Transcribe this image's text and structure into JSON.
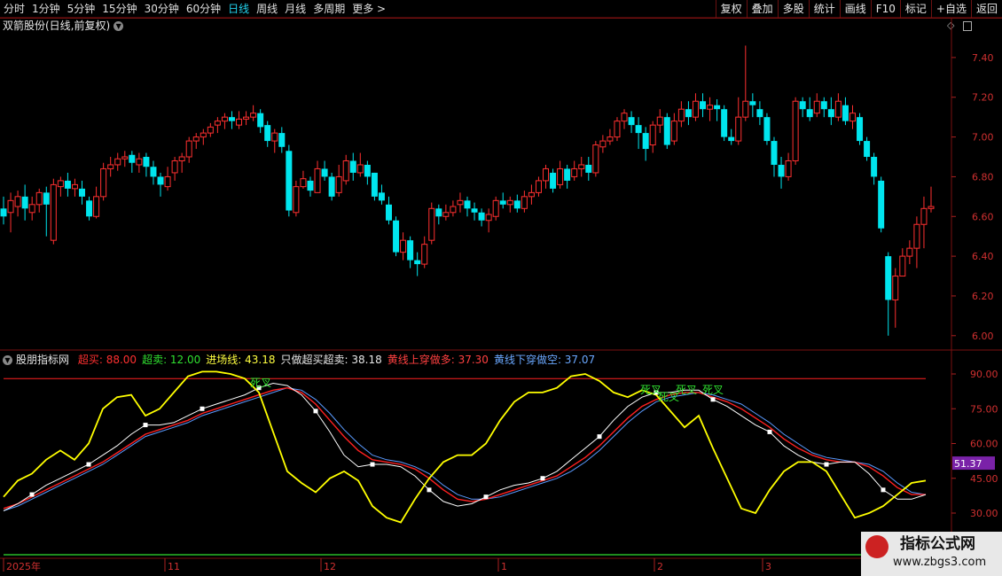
{
  "toolbar": {
    "periods": [
      "分时",
      "1分钟",
      "5分钟",
      "15分钟",
      "30分钟",
      "60分钟",
      "日线",
      "周线",
      "月线",
      "多周期",
      "更多 >"
    ],
    "active_period": "日线",
    "right_buttons": [
      "复权",
      "叠加",
      "多股",
      "统计",
      "画线",
      "F10",
      "标记",
      "+自选",
      "返回"
    ]
  },
  "stock": {
    "title": "双箭股份(日线,前复权)"
  },
  "price_axis": {
    "labels": [
      "7.40",
      "7.20",
      "7.00",
      "6.80",
      "6.60",
      "6.40",
      "6.20",
      "6.00"
    ]
  },
  "indicator": {
    "name": "股朋指标网",
    "params": [
      {
        "label": "超买: 88.00",
        "color": "#ff3030"
      },
      {
        "label": "超卖: 12.00",
        "color": "#30e030"
      },
      {
        "label": "进场线: 43.18",
        "color": "#ffff40"
      },
      {
        "label": "只做超买超卖: 38.18",
        "color": "#e8e8e8"
      },
      {
        "label": "黄线上穿做多: 37.30",
        "color": "#ff4040"
      },
      {
        "label": "黄线下穿做空: 37.07",
        "color": "#6aa8ff"
      }
    ],
    "axis_labels": [
      "90.00",
      "75.00",
      "60.00",
      "45.00",
      "30.00"
    ],
    "current_value": "51.37",
    "signals": [
      "死叉",
      "死叉",
      "死叉",
      "死叉"
    ]
  },
  "date_axis": {
    "labels": [
      "2025年",
      "11",
      "12",
      "1",
      "2",
      "3"
    ]
  },
  "watermark": {
    "text": "指标公式网",
    "url": "www.zbgs3.com"
  },
  "colors": {
    "up": "#ff3030",
    "down": "#00e5ee",
    "yellow": "#ffff00",
    "white": "#ffffff",
    "red_line": "#ff2020",
    "blue_line": "#5a9bff"
  },
  "chart_data": {
    "type": "candlestick",
    "candles": [
      [
        6.64,
        6.6,
        6.7,
        6.56
      ],
      [
        6.62,
        6.68,
        6.72,
        6.52
      ],
      [
        6.65,
        6.7,
        6.73,
        6.6
      ],
      [
        6.7,
        6.64,
        6.76,
        6.58
      ],
      [
        6.62,
        6.66,
        6.7,
        6.58
      ],
      [
        6.66,
        6.72,
        6.74,
        6.62
      ],
      [
        6.72,
        6.66,
        6.75,
        6.5
      ],
      [
        6.48,
        6.76,
        6.79,
        6.46
      ],
      [
        6.75,
        6.78,
        6.8,
        6.7
      ],
      [
        6.78,
        6.74,
        6.82,
        6.7
      ],
      [
        6.74,
        6.76,
        6.79,
        6.7
      ],
      [
        6.74,
        6.7,
        6.78,
        6.66
      ],
      [
        6.68,
        6.6,
        6.7,
        6.58
      ],
      [
        6.6,
        6.7,
        6.75,
        6.59
      ],
      [
        6.7,
        6.84,
        6.87,
        6.68
      ],
      [
        6.84,
        6.86,
        6.9,
        6.8
      ],
      [
        6.86,
        6.89,
        6.92,
        6.83
      ],
      [
        6.89,
        6.9,
        6.93,
        6.85
      ],
      [
        6.91,
        6.87,
        6.93,
        6.82
      ],
      [
        6.86,
        6.89,
        6.92,
        6.82
      ],
      [
        6.9,
        6.85,
        6.92,
        6.8
      ],
      [
        6.85,
        6.8,
        6.88,
        6.76
      ],
      [
        6.8,
        6.76,
        6.82,
        6.7
      ],
      [
        6.75,
        6.8,
        6.85,
        6.73
      ],
      [
        6.82,
        6.88,
        6.9,
        6.78
      ],
      [
        6.88,
        6.9,
        6.92,
        6.82
      ],
      [
        6.9,
        6.98,
        7.0,
        6.87
      ],
      [
        6.98,
        7.0,
        7.02,
        6.94
      ],
      [
        7.0,
        7.02,
        7.04,
        6.96
      ],
      [
        7.02,
        7.05,
        7.07,
        7.0
      ],
      [
        7.06,
        7.08,
        7.1,
        7.02
      ],
      [
        7.08,
        7.1,
        7.12,
        7.04
      ],
      [
        7.1,
        7.08,
        7.13,
        7.04
      ],
      [
        7.06,
        7.09,
        7.13,
        7.04
      ],
      [
        7.09,
        7.1,
        7.13,
        7.06
      ],
      [
        7.1,
        7.12,
        7.16,
        7.08
      ],
      [
        7.12,
        7.05,
        7.14,
        7.02
      ],
      [
        7.06,
        6.98,
        7.08,
        6.95
      ],
      [
        6.98,
        7.02,
        7.04,
        6.92
      ],
      [
        7.02,
        6.95,
        7.05,
        6.92
      ],
      [
        6.93,
        6.63,
        6.96,
        6.6
      ],
      [
        6.62,
        6.75,
        6.78,
        6.6
      ],
      [
        6.75,
        6.79,
        6.83,
        6.74
      ],
      [
        6.78,
        6.73,
        6.8,
        6.7
      ],
      [
        6.72,
        6.84,
        6.88,
        6.72
      ],
      [
        6.84,
        6.8,
        6.88,
        6.78
      ],
      [
        6.8,
        6.7,
        6.82,
        6.68
      ],
      [
        6.72,
        6.8,
        6.86,
        6.7
      ],
      [
        6.78,
        6.88,
        6.91,
        6.76
      ],
      [
        6.88,
        6.82,
        6.92,
        6.78
      ],
      [
        6.82,
        6.86,
        6.92,
        6.8
      ],
      [
        6.86,
        6.8,
        6.88,
        6.76
      ],
      [
        6.82,
        6.7,
        6.82,
        6.68
      ],
      [
        6.72,
        6.68,
        6.76,
        6.66
      ],
      [
        6.66,
        6.58,
        6.7,
        6.56
      ],
      [
        6.58,
        6.42,
        6.6,
        6.4
      ],
      [
        6.42,
        6.48,
        6.52,
        6.38
      ],
      [
        6.48,
        6.38,
        6.5,
        6.34
      ],
      [
        6.38,
        6.36,
        6.42,
        6.3
      ],
      [
        6.36,
        6.46,
        6.5,
        6.34
      ],
      [
        6.48,
        6.64,
        6.67,
        6.46
      ],
      [
        6.64,
        6.6,
        6.66,
        6.56
      ],
      [
        6.6,
        6.62,
        6.66,
        6.58
      ],
      [
        6.62,
        6.65,
        6.68,
        6.6
      ],
      [
        6.66,
        6.68,
        6.72,
        6.62
      ],
      [
        6.68,
        6.64,
        6.7,
        6.6
      ],
      [
        6.64,
        6.62,
        6.67,
        6.58
      ],
      [
        6.62,
        6.58,
        6.64,
        6.55
      ],
      [
        6.58,
        6.61,
        6.64,
        6.52
      ],
      [
        6.6,
        6.68,
        6.7,
        6.58
      ],
      [
        6.68,
        6.66,
        6.72,
        6.64
      ],
      [
        6.66,
        6.68,
        6.7,
        6.62
      ],
      [
        6.68,
        6.64,
        6.71,
        6.62
      ],
      [
        6.64,
        6.7,
        6.73,
        6.62
      ],
      [
        6.7,
        6.72,
        6.76,
        6.66
      ],
      [
        6.72,
        6.78,
        6.8,
        6.7
      ],
      [
        6.78,
        6.84,
        6.86,
        6.74
      ],
      [
        6.82,
        6.74,
        6.84,
        6.72
      ],
      [
        6.76,
        6.84,
        6.88,
        6.74
      ],
      [
        6.84,
        6.78,
        6.86,
        6.74
      ],
      [
        6.8,
        6.84,
        6.88,
        6.78
      ],
      [
        6.84,
        6.86,
        6.9,
        6.8
      ],
      [
        6.86,
        6.82,
        6.9,
        6.78
      ],
      [
        6.82,
        6.96,
        6.98,
        6.8
      ],
      [
        6.95,
        6.98,
        7.01,
        6.92
      ],
      [
        6.98,
        7.0,
        7.04,
        6.96
      ],
      [
        7.0,
        7.08,
        7.1,
        6.98
      ],
      [
        7.08,
        7.12,
        7.14,
        7.04
      ],
      [
        7.1,
        7.06,
        7.13,
        7.02
      ],
      [
        7.06,
        7.02,
        7.1,
        6.94
      ],
      [
        7.02,
        6.94,
        7.05,
        6.88
      ],
      [
        6.96,
        7.06,
        7.08,
        6.92
      ],
      [
        7.06,
        7.1,
        7.14,
        7.02
      ],
      [
        7.1,
        6.96,
        7.12,
        6.94
      ],
      [
        6.98,
        7.08,
        7.12,
        6.96
      ],
      [
        7.08,
        7.14,
        7.18,
        7.05
      ],
      [
        7.14,
        7.1,
        7.18,
        7.06
      ],
      [
        7.1,
        7.18,
        7.22,
        7.08
      ],
      [
        7.18,
        7.14,
        7.22,
        7.1
      ],
      [
        7.14,
        7.16,
        7.2,
        7.08
      ],
      [
        7.16,
        7.14,
        7.19,
        7.08
      ],
      [
        7.14,
        7.0,
        7.16,
        6.98
      ],
      [
        7.0,
        6.98,
        7.04,
        6.96
      ],
      [
        6.98,
        7.1,
        7.2,
        6.96
      ],
      [
        7.1,
        7.18,
        7.46,
        7.08
      ],
      [
        7.18,
        7.16,
        7.22,
        7.1
      ],
      [
        7.14,
        7.1,
        7.18,
        7.06
      ],
      [
        7.1,
        6.98,
        7.12,
        6.96
      ],
      [
        6.98,
        6.86,
        7.0,
        6.8
      ],
      [
        6.86,
        6.8,
        6.9,
        6.74
      ],
      [
        6.8,
        6.88,
        6.92,
        6.78
      ],
      [
        6.88,
        7.18,
        7.2,
        6.86
      ],
      [
        7.18,
        7.14,
        7.2,
        7.1
      ],
      [
        7.14,
        7.1,
        7.2,
        7.08
      ],
      [
        7.12,
        7.18,
        7.22,
        7.1
      ],
      [
        7.18,
        7.14,
        7.2,
        7.1
      ],
      [
        7.14,
        7.1,
        7.2,
        7.06
      ],
      [
        7.1,
        7.18,
        7.22,
        7.08
      ],
      [
        7.16,
        7.08,
        7.2,
        7.06
      ],
      [
        7.08,
        7.12,
        7.16,
        7.04
      ],
      [
        7.1,
        6.98,
        7.12,
        6.96
      ],
      [
        6.98,
        6.9,
        7.0,
        6.88
      ],
      [
        6.9,
        6.8,
        6.92,
        6.76
      ],
      [
        6.78,
        6.54,
        6.8,
        6.52
      ],
      [
        6.4,
        6.18,
        6.42,
        6.0
      ],
      [
        6.18,
        6.3,
        6.34,
        6.04
      ],
      [
        6.3,
        6.4,
        6.44,
        6.3
      ],
      [
        6.4,
        6.44,
        6.48,
        6.36
      ],
      [
        6.44,
        6.56,
        6.6,
        6.34
      ],
      [
        6.56,
        6.64,
        6.7,
        6.44
      ],
      [
        6.64,
        6.65,
        6.75,
        6.62
      ]
    ],
    "ylim": [
      5.95,
      7.52
    ],
    "indicator_series": {
      "white": [
        31,
        34,
        38,
        42,
        45,
        48,
        51,
        55,
        59,
        64,
        68,
        68,
        69,
        72,
        75,
        77,
        79,
        81,
        84,
        86,
        85,
        81,
        74,
        65,
        55,
        50,
        51,
        51,
        50,
        46,
        40,
        35,
        33,
        34,
        37,
        40,
        42,
        43,
        45,
        48,
        53,
        58,
        63,
        70,
        76,
        80,
        82,
        82,
        83,
        83,
        79,
        76,
        72,
        68,
        65,
        59,
        55,
        52,
        51,
        52,
        52,
        47,
        40,
        36,
        36,
        38
      ],
      "red": [
        32,
        34,
        37,
        40,
        43,
        46,
        49,
        52,
        56,
        60,
        64,
        66,
        68,
        70,
        73,
        75,
        77,
        79,
        81,
        83,
        84,
        82,
        77,
        70,
        63,
        57,
        53,
        52,
        51,
        49,
        45,
        40,
        36,
        35,
        36,
        38,
        40,
        42,
        44,
        46,
        50,
        54,
        59,
        65,
        71,
        76,
        79,
        81,
        82,
        82,
        80,
        78,
        75,
        71,
        67,
        62,
        58,
        55,
        53,
        52,
        52,
        50,
        46,
        41,
        38,
        38
      ],
      "blue": [
        31,
        33,
        36,
        39,
        42,
        45,
        48,
        51,
        55,
        59,
        63,
        65,
        67,
        69,
        72,
        74,
        76,
        78,
        80,
        82,
        84,
        83,
        79,
        73,
        66,
        60,
        55,
        53,
        52,
        50,
        47,
        42,
        38,
        36,
        36,
        37,
        39,
        41,
        43,
        45,
        48,
        52,
        57,
        63,
        69,
        74,
        78,
        80,
        81,
        82,
        81,
        79,
        77,
        73,
        69,
        64,
        60,
        56,
        54,
        53,
        52,
        51,
        48,
        43,
        39,
        38
      ],
      "yellow": [
        37,
        44,
        47,
        53,
        57,
        53,
        60,
        75,
        80,
        81,
        72,
        75,
        82,
        89,
        91,
        91,
        90,
        88,
        82,
        65,
        48,
        43,
        39,
        45,
        48,
        44,
        33,
        28,
        26,
        36,
        45,
        52,
        55,
        55,
        60,
        70,
        78,
        82,
        82,
        84,
        89,
        90,
        87,
        82,
        80,
        83,
        81,
        74,
        67,
        72,
        58,
        45,
        32,
        30,
        40,
        48,
        52,
        52,
        48,
        38,
        28,
        30,
        33,
        38,
        43,
        44
      ]
    }
  }
}
